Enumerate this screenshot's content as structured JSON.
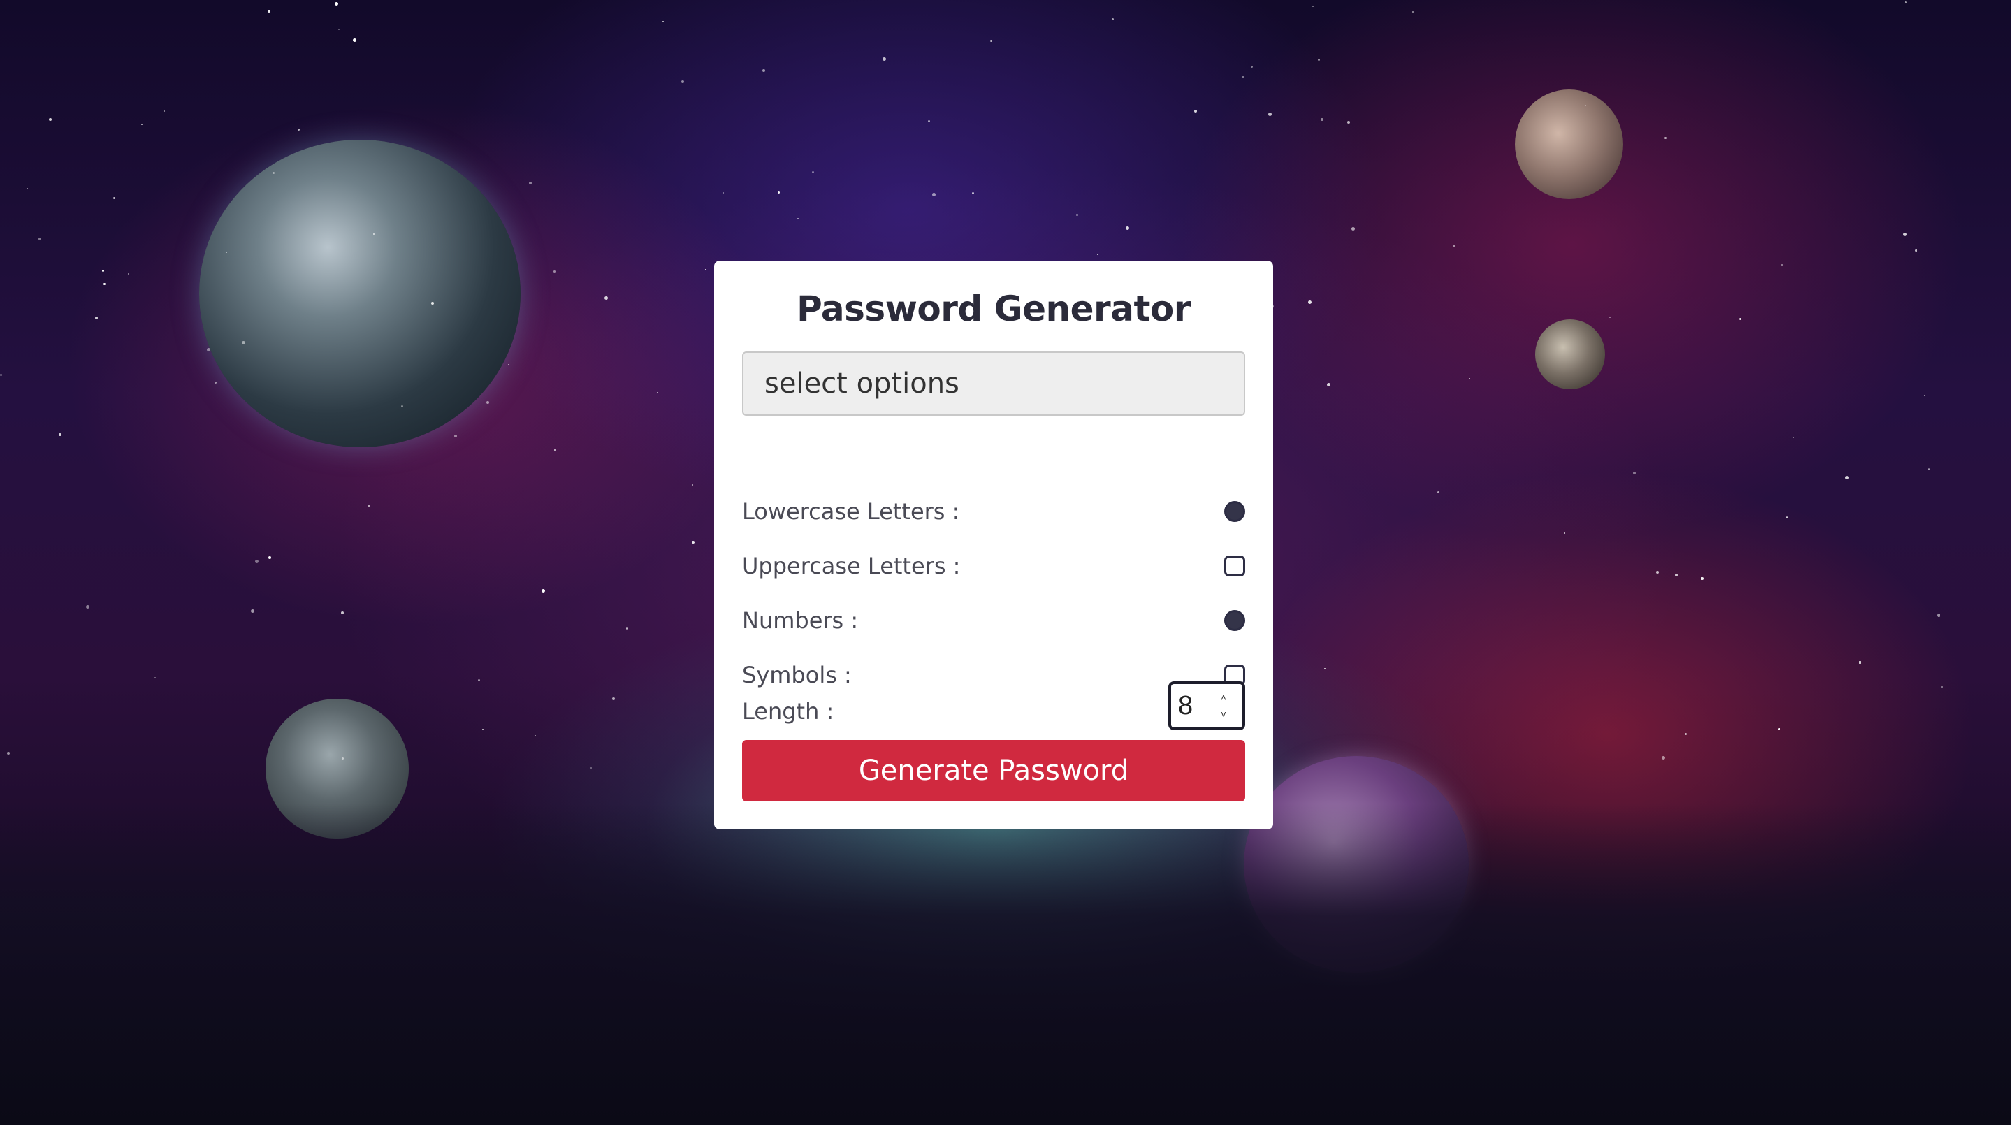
{
  "app": {
    "title": "Password Generator"
  },
  "result_field": {
    "placeholder": "select options",
    "value": ""
  },
  "options": [
    {
      "label": "Lowercase Letters :",
      "checked": true
    },
    {
      "label": "Uppercase Letters :",
      "checked": false
    },
    {
      "label": "Numbers :",
      "checked": true
    },
    {
      "label": "Symbols :",
      "checked": false
    }
  ],
  "length": {
    "label": "Length :",
    "value": "8"
  },
  "generate_button": {
    "label": "Generate Password"
  },
  "colors": {
    "button": "#d0293f",
    "title": "#2b2b3a",
    "checkbox": "#343449"
  }
}
